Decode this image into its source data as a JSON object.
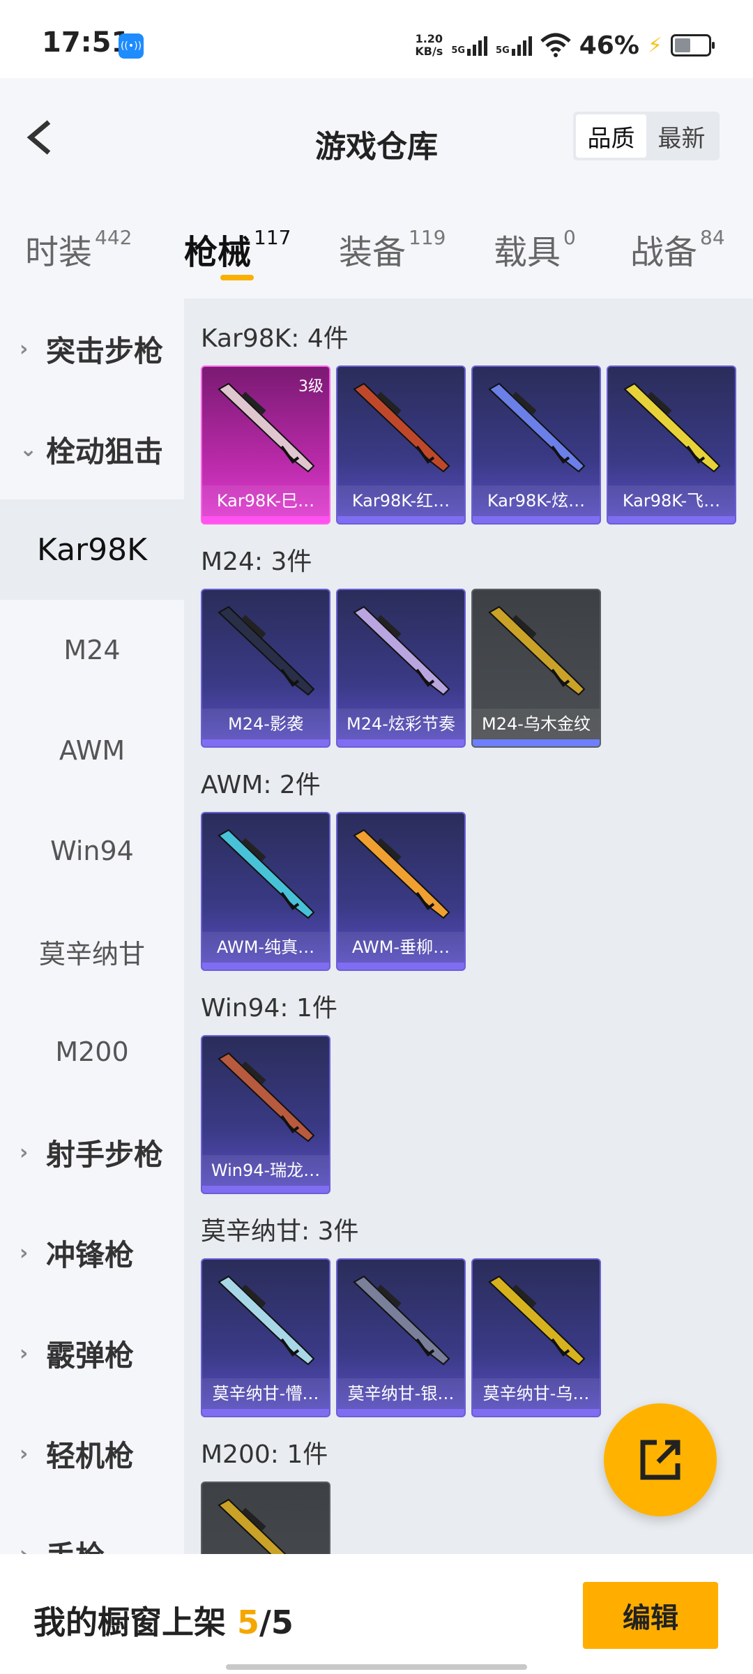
{
  "status_bar": {
    "time": "17:51",
    "net_speed_value": "1.20",
    "net_speed_unit": "KB/s",
    "sim1": "5G",
    "sim2": "5G",
    "battery": "46%"
  },
  "header": {
    "title": "游戏仓库",
    "sort_options": [
      "品质",
      "最新"
    ],
    "sort_selected": "品质"
  },
  "tabs": [
    {
      "label": "时装",
      "count": "442"
    },
    {
      "label": "枪械",
      "count": "117",
      "active": true
    },
    {
      "label": "装备",
      "count": "119"
    },
    {
      "label": "载具",
      "count": "0"
    },
    {
      "label": "战备",
      "count": "84"
    }
  ],
  "sidebar": [
    {
      "label": "突击步枪",
      "type": "category",
      "expanded": false
    },
    {
      "label": "栓动狙击",
      "type": "category",
      "expanded": true
    },
    {
      "label": "Kar98K",
      "type": "sub",
      "selected": true
    },
    {
      "label": "M24",
      "type": "sub"
    },
    {
      "label": "AWM",
      "type": "sub"
    },
    {
      "label": "Win94",
      "type": "sub"
    },
    {
      "label": "莫辛纳甘",
      "type": "sub"
    },
    {
      "label": "M200",
      "type": "sub"
    },
    {
      "label": "射手步枪",
      "type": "category",
      "expanded": false
    },
    {
      "label": "冲锋枪",
      "type": "category",
      "expanded": false
    },
    {
      "label": "霰弹枪",
      "type": "category",
      "expanded": false
    },
    {
      "label": "轻机枪",
      "type": "category",
      "expanded": false
    },
    {
      "label": "手枪",
      "type": "category",
      "expanded": false
    }
  ],
  "groups": [
    {
      "title": "Kar98K: 4件",
      "items": [
        {
          "name": "Kar98K-巳…",
          "rarity": "pink",
          "level": "3级",
          "color": "#e0c6cf"
        },
        {
          "name": "Kar98K-红…",
          "rarity": "purple",
          "color": "#c0482a"
        },
        {
          "name": "Kar98K-炫…",
          "rarity": "purple",
          "color": "#6a7fe8"
        },
        {
          "name": "Kar98K-飞…",
          "rarity": "purple",
          "color": "#e8d23a"
        }
      ]
    },
    {
      "title": "M24: 3件",
      "items": [
        {
          "name": "M24-影袭",
          "rarity": "purple",
          "color": "#2a2f48"
        },
        {
          "name": "M24-炫彩节奏",
          "rarity": "purple",
          "color": "#b9a6e0"
        },
        {
          "name": "M24-乌木金纹",
          "rarity": "gray",
          "color": "#c9a227"
        }
      ]
    },
    {
      "title": "AWM: 2件",
      "items": [
        {
          "name": "AWM-纯真…",
          "rarity": "purple",
          "color": "#48c2d8"
        },
        {
          "name": "AWM-垂柳…",
          "rarity": "purple",
          "color": "#f0a030"
        }
      ]
    },
    {
      "title": "Win94: 1件",
      "items": [
        {
          "name": "Win94-瑞龙…",
          "rarity": "purple",
          "color": "#b85a3e"
        }
      ]
    },
    {
      "title": "莫辛纳甘: 3件",
      "items": [
        {
          "name": "莫辛纳甘-懵…",
          "rarity": "purple",
          "color": "#a8d8e8"
        },
        {
          "name": "莫辛纳甘-银…",
          "rarity": "purple",
          "color": "#7a7f9a"
        },
        {
          "name": "莫辛纳甘-乌…",
          "rarity": "purple",
          "color": "#d6b21f"
        }
      ]
    },
    {
      "title": "M200: 1件",
      "items": [
        {
          "name": "",
          "rarity": "gray",
          "color": "#c9a227"
        }
      ]
    }
  ],
  "bottom": {
    "showcase_label": "我的橱窗上架",
    "current": "5",
    "total": "/5",
    "edit_label": "编辑"
  }
}
